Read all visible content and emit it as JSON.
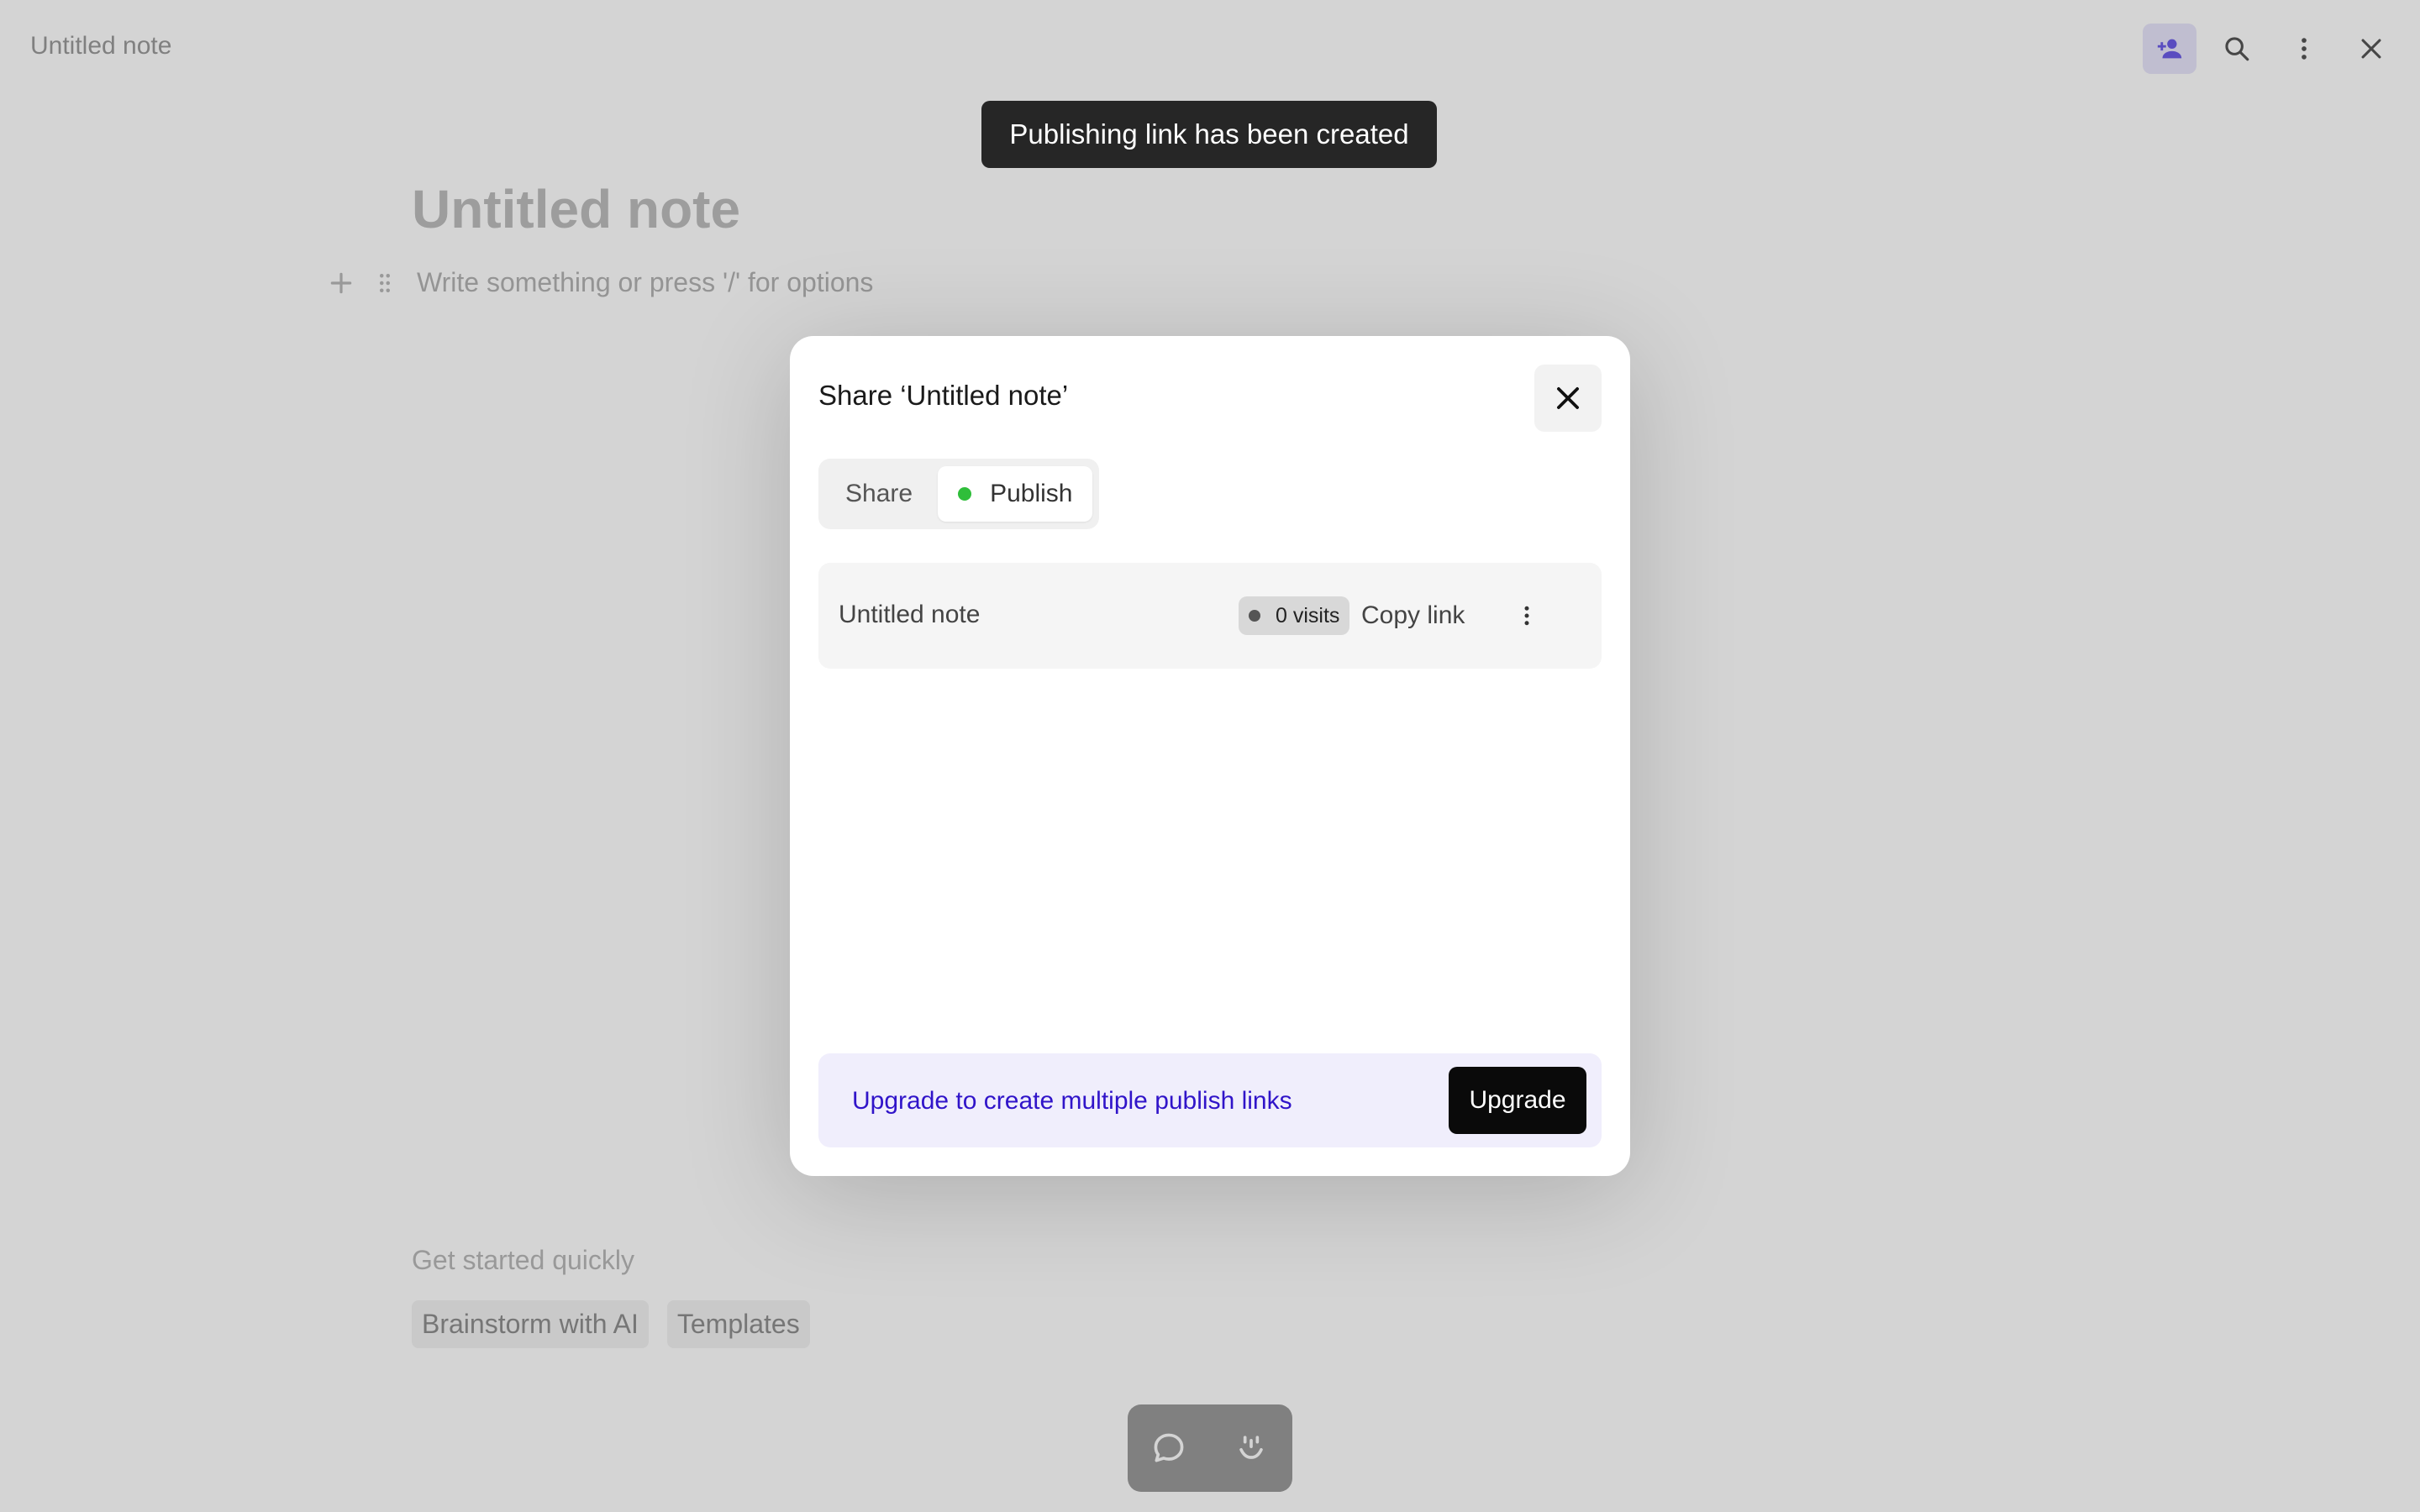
{
  "header": {
    "doc_label": "Untitled note",
    "actions": [
      {
        "icon": "share-person-icon",
        "active": true
      },
      {
        "icon": "search-icon"
      },
      {
        "icon": "more-vertical-icon"
      },
      {
        "icon": "close-icon"
      }
    ]
  },
  "editor": {
    "title": "Untitled note",
    "placeholder": "Write something or press '/' for options",
    "get_started_label": "Get started quickly",
    "chips": [
      "Brainstorm with AI",
      "Templates"
    ]
  },
  "dock": {
    "icons": [
      "chat-bubble-icon",
      "smile-face-icon"
    ]
  },
  "toast": {
    "message": "Publishing link has been created"
  },
  "modal": {
    "title": "Share ‘Untitled note’",
    "tabs": [
      {
        "label": "Share",
        "active": false
      },
      {
        "label": "Publish",
        "active": true,
        "status_dot_color": "#2fbe3a"
      }
    ],
    "link": {
      "name": "Untitled note",
      "visits": "0 visits",
      "copy_label": "Copy link"
    },
    "upgrade": {
      "text": "Upgrade to create multiple publish links",
      "button_label": "Upgrade"
    }
  },
  "colors": {
    "accent_purple": "#3014c9",
    "upgrade_bg": "#f0eefc",
    "toast_bg": "#262626",
    "status_green": "#2fbe3a"
  }
}
